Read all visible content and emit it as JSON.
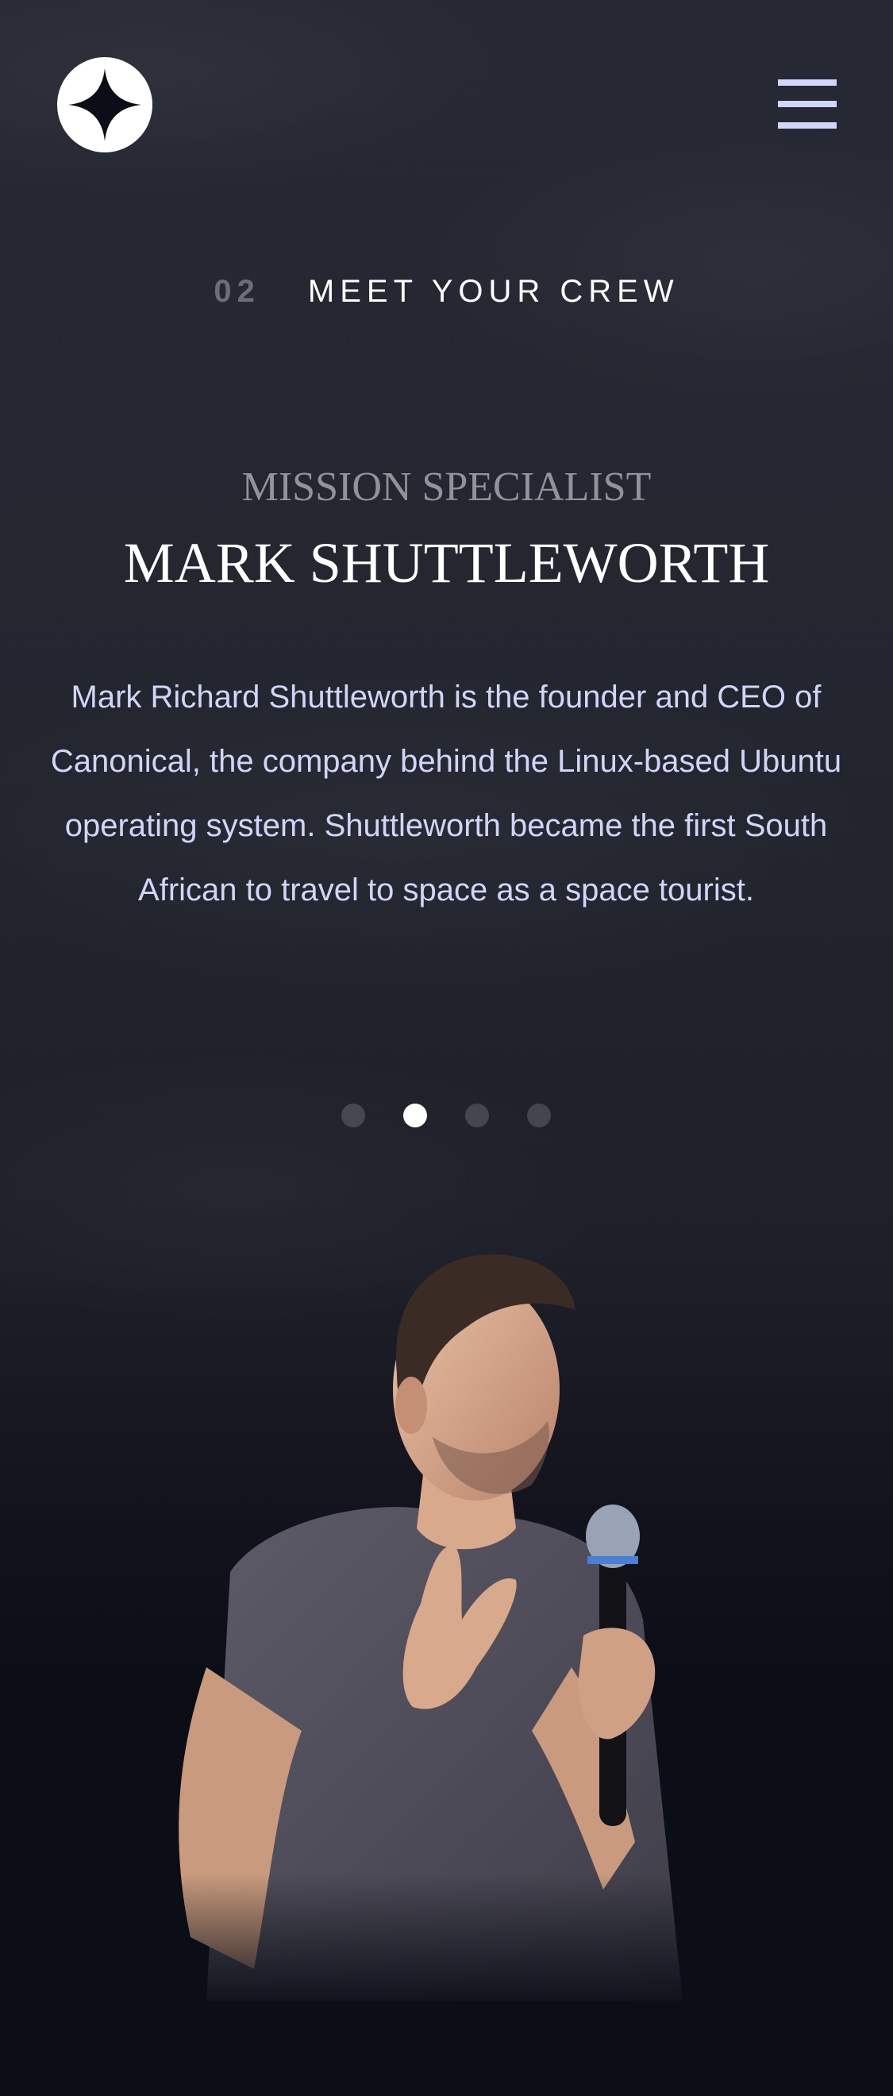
{
  "header": {
    "logo_icon": "star-logo-icon",
    "menu_icon": "hamburger-menu-icon"
  },
  "page_heading": {
    "number": "02",
    "title": "MEET YOUR CREW"
  },
  "crew": {
    "role": "MISSION SPECIALIST",
    "name": "MARK SHUTTLEWORTH",
    "bio": "Mark Richard Shuttleworth is the founder and CEO of Canonical, the company behind the Linux-based Ubuntu operating system. Shuttleworth became the first South African to travel to space as a space tourist.",
    "active_index": 1,
    "slide_count": 4
  },
  "colors": {
    "background": "#0B0D17",
    "accent_light": "#D0D6F9",
    "white": "#FFFFFF"
  }
}
